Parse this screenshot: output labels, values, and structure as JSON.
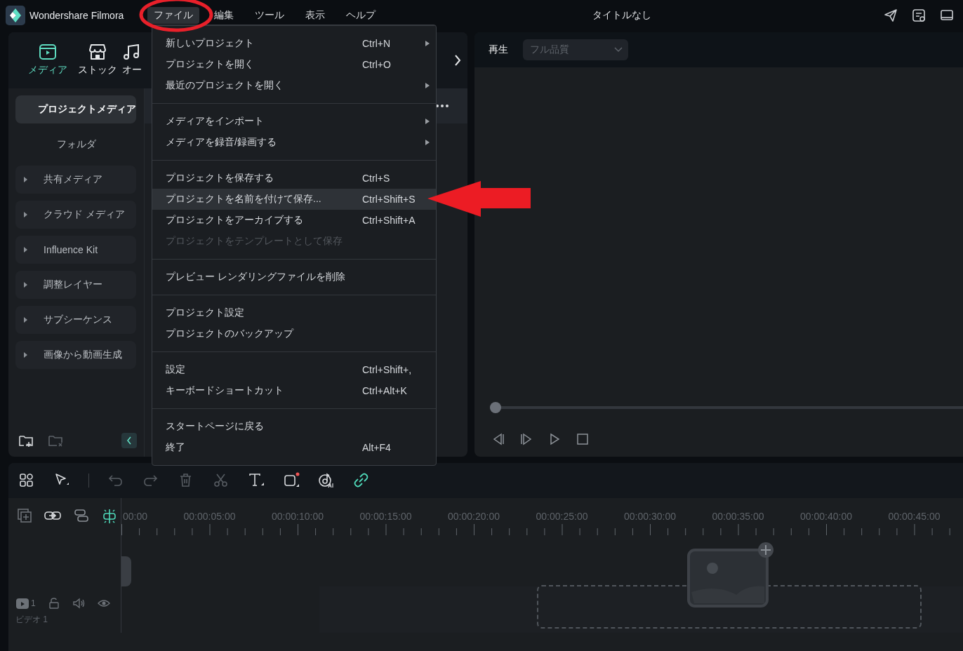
{
  "app": {
    "name": "Wondershare Filmora",
    "title": "タイトルなし"
  },
  "menubar": [
    {
      "label": "ファイル",
      "selected": true
    },
    {
      "label": "編集",
      "selected": false
    },
    {
      "label": "ツール",
      "selected": false
    },
    {
      "label": "表示",
      "selected": false
    },
    {
      "label": "ヘルプ",
      "selected": false
    }
  ],
  "media_panel": {
    "tabs": [
      {
        "label": "メディア",
        "selected": true
      },
      {
        "label": "ストック",
        "selected": false
      },
      {
        "label": "オー",
        "selected": false
      }
    ],
    "sidebar": [
      {
        "label": "プロジェクトメディア",
        "selected": true,
        "expanded": true,
        "children": [
          {
            "label": "フォルダ"
          }
        ]
      },
      {
        "label": "共有メディア",
        "selected": false,
        "expanded": false
      },
      {
        "label": "クラウド メディア",
        "selected": false,
        "expanded": false
      },
      {
        "label": "Influence Kit",
        "selected": false,
        "expanded": false
      },
      {
        "label": "調整レイヤー",
        "selected": false,
        "expanded": false
      },
      {
        "label": "サブシーケンス",
        "selected": false,
        "expanded": false
      },
      {
        "label": "画像から動画生成",
        "selected": false,
        "expanded": false
      }
    ]
  },
  "preview": {
    "tab": "再生",
    "quality": {
      "value": "フル品質",
      "disabled": true
    },
    "progress": {
      "level": 0
    }
  },
  "timeline": {
    "ruler": [
      "00:00",
      "00:00:05:00",
      "00:00:10:00",
      "00:00:15:00",
      "00:00:20:00",
      "00:00:25:00",
      "00:00:30:00",
      "00:00:35:00",
      "00:00:40:00",
      "00:00:45:00"
    ],
    "tracks": [
      {
        "number": "1",
        "name": "ビデオ 1"
      }
    ]
  },
  "file_menu": {
    "groups": [
      [
        {
          "label": "新しいプロジェクト",
          "shortcut": "Ctrl+N",
          "submenu": true,
          "disabled": false,
          "selected": false
        },
        {
          "label": "プロジェクトを開く",
          "shortcut": "Ctrl+O",
          "submenu": false,
          "disabled": false,
          "selected": false
        },
        {
          "label": "最近のプロジェクトを開く",
          "submenu": true,
          "disabled": false,
          "selected": false
        }
      ],
      [
        {
          "label": "メディアをインポート",
          "submenu": true,
          "disabled": false,
          "selected": false
        },
        {
          "label": "メディアを録音/録画する",
          "submenu": true,
          "disabled": false,
          "selected": false
        }
      ],
      [
        {
          "label": "プロジェクトを保存する",
          "shortcut": "Ctrl+S",
          "submenu": false,
          "disabled": false,
          "selected": false
        },
        {
          "label": "プロジェクトを名前を付けて保存...",
          "shortcut": "Ctrl+Shift+S",
          "submenu": false,
          "disabled": false,
          "selected": true
        },
        {
          "label": "プロジェクトをアーカイブする",
          "shortcut": "Ctrl+Shift+A",
          "submenu": false,
          "disabled": false,
          "selected": false
        },
        {
          "label": "プロジェクトをテンプレートとして保存",
          "submenu": false,
          "disabled": true,
          "selected": false
        }
      ],
      [
        {
          "label": "プレビュー レンダリングファイルを削除",
          "submenu": false,
          "disabled": false,
          "selected": false
        }
      ],
      [
        {
          "label": "プロジェクト設定",
          "submenu": false,
          "disabled": false,
          "selected": false
        },
        {
          "label": "プロジェクトのバックアップ",
          "submenu": false,
          "disabled": false,
          "selected": false
        }
      ],
      [
        {
          "label": "設定",
          "shortcut": "Ctrl+Shift+,",
          "submenu": false,
          "disabled": false,
          "selected": false
        },
        {
          "label": "キーボードショートカット",
          "shortcut": "Ctrl+Alt+K",
          "submenu": false,
          "disabled": false,
          "selected": false
        }
      ],
      [
        {
          "label": "スタートページに戻る",
          "submenu": false,
          "disabled": false,
          "selected": false
        },
        {
          "label": "終了",
          "shortcut": "Alt+F4",
          "submenu": false,
          "disabled": false,
          "selected": false
        }
      ]
    ]
  },
  "annotations": {
    "circle_on_file_menu": true,
    "arrow_to_highlighted_item": true
  }
}
